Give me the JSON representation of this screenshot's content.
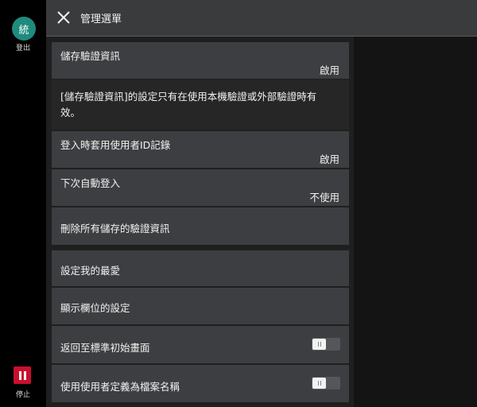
{
  "header": {
    "title": "管理選單"
  },
  "left_bar": {
    "avatar_letter": "統",
    "logout_label": "登出",
    "stop_label": "停止"
  },
  "settings": {
    "save_credentials": {
      "label": "儲存驗證資訊",
      "value": "啟用"
    },
    "info_text": "[儲存驗證資訊]的設定只有在使用本機驗證或外部驗證時有效。",
    "apply_user_id_on_login": {
      "label": "登入時套用使用者ID記錄",
      "value": "啟用"
    },
    "auto_login_next": {
      "label": "下次自動登入",
      "value": "不使用"
    },
    "delete_saved_credentials": {
      "label": "刪除所有儲存的驗證資訊"
    },
    "set_favorites": {
      "label": "設定我的最愛"
    },
    "display_fields": {
      "label": "顯示欄位的設定"
    },
    "return_home": {
      "label": "返回至標準初始畫面",
      "toggle": "off"
    },
    "user_defined_filename": {
      "label": "使用使用者定義為檔案名稱",
      "toggle": "off"
    }
  },
  "colors": {
    "avatar": "#1f8a7e",
    "stop": "#c8102e",
    "header": "#3a3b3d",
    "item": "#3d3e41"
  }
}
